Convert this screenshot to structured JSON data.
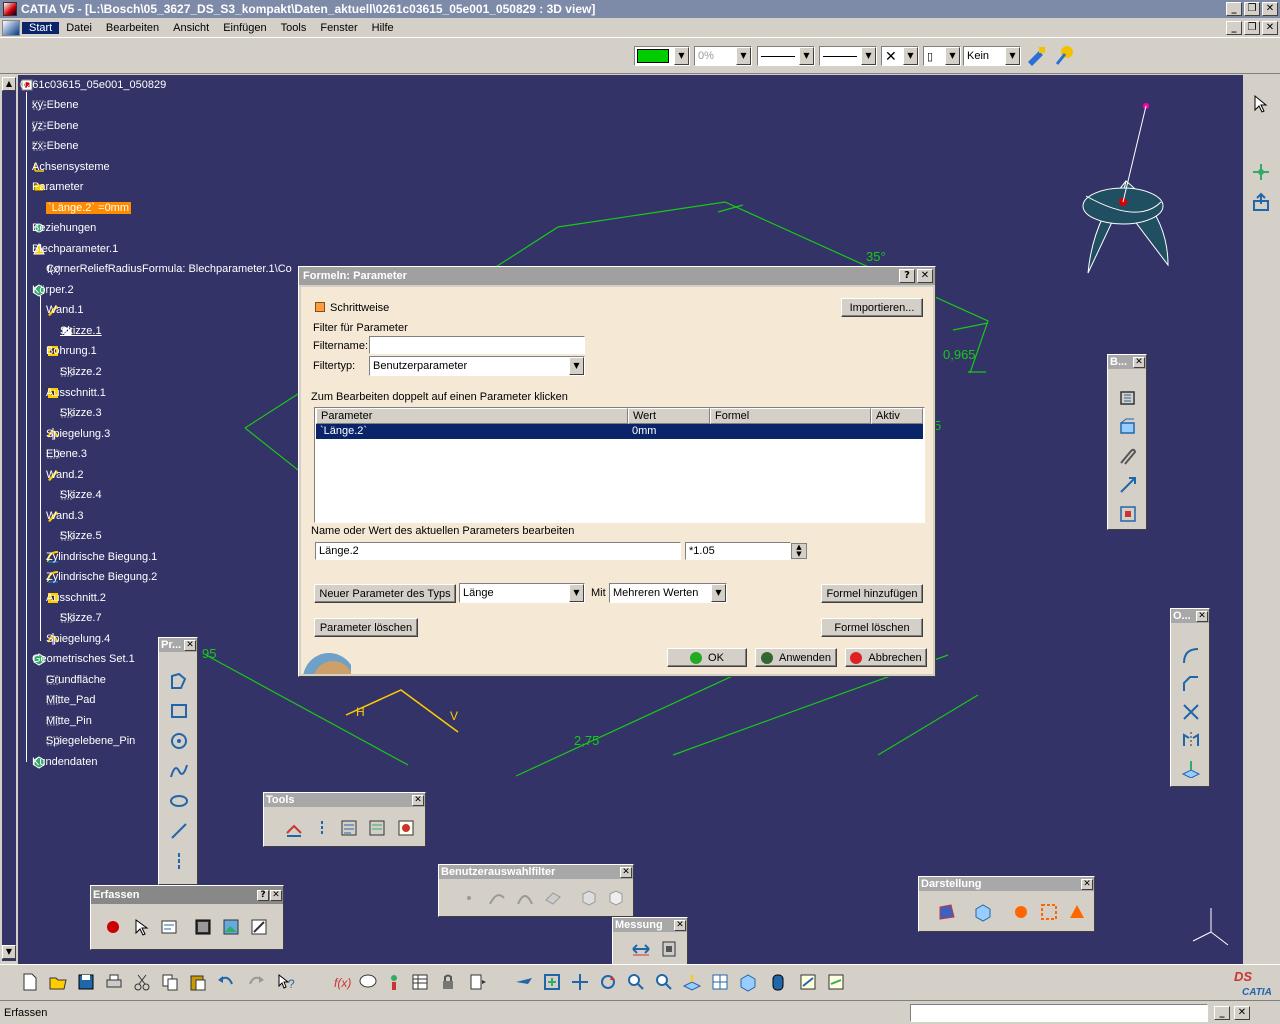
{
  "window": {
    "title": "CATIA V5 - [L:\\Bosch\\05_3627_DS_S3_kompakt\\Daten_aktuell\\0261c03615_05e001_050829 : 3D view]"
  },
  "menu": [
    "Start",
    "Datei",
    "Bearbeiten",
    "Ansicht",
    "Einfügen",
    "Tools",
    "Fenster",
    "Hilfe"
  ],
  "format_toolbar": {
    "color_value": "#00cc00",
    "transparency": "0%",
    "layer": "Kein"
  },
  "tree": {
    "root": "0261c03615_05e001_050829",
    "items": [
      {
        "label": "xy-Ebene"
      },
      {
        "label": "yz-Ebene"
      },
      {
        "label": "zx-Ebene"
      },
      {
        "label": "Achsensysteme"
      },
      {
        "label": "Parameter"
      },
      {
        "label": "`Länge.2` =0mm"
      },
      {
        "label": "Beziehungen"
      },
      {
        "label": "Blechparameter.1"
      },
      {
        "label": "CornerReliefRadiusFormula: Blechparameter.1\\Co"
      },
      {
        "label": "Körper.2"
      },
      {
        "label": "Wand.1"
      },
      {
        "label": "Skizze.1"
      },
      {
        "label": "Bohrung.1"
      },
      {
        "label": "Skizze.2"
      },
      {
        "label": "Ausschnitt.1"
      },
      {
        "label": "Skizze.3"
      },
      {
        "label": "Spiegelung.3"
      },
      {
        "label": "Ebene.3"
      },
      {
        "label": "Wand.2"
      },
      {
        "label": "Skizze.4"
      },
      {
        "label": "Wand.3"
      },
      {
        "label": "Skizze.5"
      },
      {
        "label": "Zylindrische Biegung.1"
      },
      {
        "label": "Zylindrische Biegung.2"
      },
      {
        "label": "Ausschnitt.2"
      },
      {
        "label": "Skizze.7"
      },
      {
        "label": "Spiegelung.4"
      },
      {
        "label": "Geometrisches Set.1"
      },
      {
        "label": "Grundfläche"
      },
      {
        "label": "Mitte_Pad"
      },
      {
        "label": "Mitte_Pin"
      },
      {
        "label": "Spiegelebene_Pin"
      },
      {
        "label": "Kundendaten"
      }
    ]
  },
  "dims": {
    "d35": "35°",
    "d0965": "0,965",
    "d275": "2,75",
    "d95": "95",
    "d5": "5",
    "dH": "H",
    "dV": "V"
  },
  "toolbars": {
    "pr": "Pr...",
    "b": "B...",
    "o": "O...",
    "tools": "Tools",
    "benutzer": "Benutzerauswahlfilter",
    "messung": "Messung",
    "darstellung": "Darstellung",
    "erfassen": "Erfassen"
  },
  "dialog": {
    "title": "Formeln: Parameter",
    "schrittweise": "Schrittweise",
    "importieren": "Importieren...",
    "filter_label": "Filter für Parameter",
    "filtername_label": "Filtername:",
    "filtername_value": "",
    "filtertyp_label": "Filtertyp:",
    "filtertyp_value": "Benutzerparameter",
    "edit_hint": "Zum Bearbeiten doppelt auf einen Parameter klicken",
    "columns": [
      "Parameter",
      "Wert",
      "Formel",
      "Aktiv"
    ],
    "rows": [
      {
        "parameter": "`Länge.2`",
        "wert": "0mm",
        "formel": "",
        "aktiv": ""
      }
    ],
    "edit_label": "Name oder Wert des aktuellen Parameters bearbeiten",
    "name_value": "Länge.2",
    "value_value": "*1.05",
    "new_param": "Neuer Parameter des Typs",
    "type_value": "Länge",
    "mit": "Mit",
    "werte_value": "Mehreren Werten",
    "formel_hinzufuegen": "Formel hinzufügen",
    "param_loeschen": "Parameter löschen",
    "formel_loeschen": "Formel löschen",
    "ok": "OK",
    "anwenden": "Anwenden",
    "abbrechen": "Abbrechen"
  },
  "status": {
    "text": "Erfassen"
  }
}
